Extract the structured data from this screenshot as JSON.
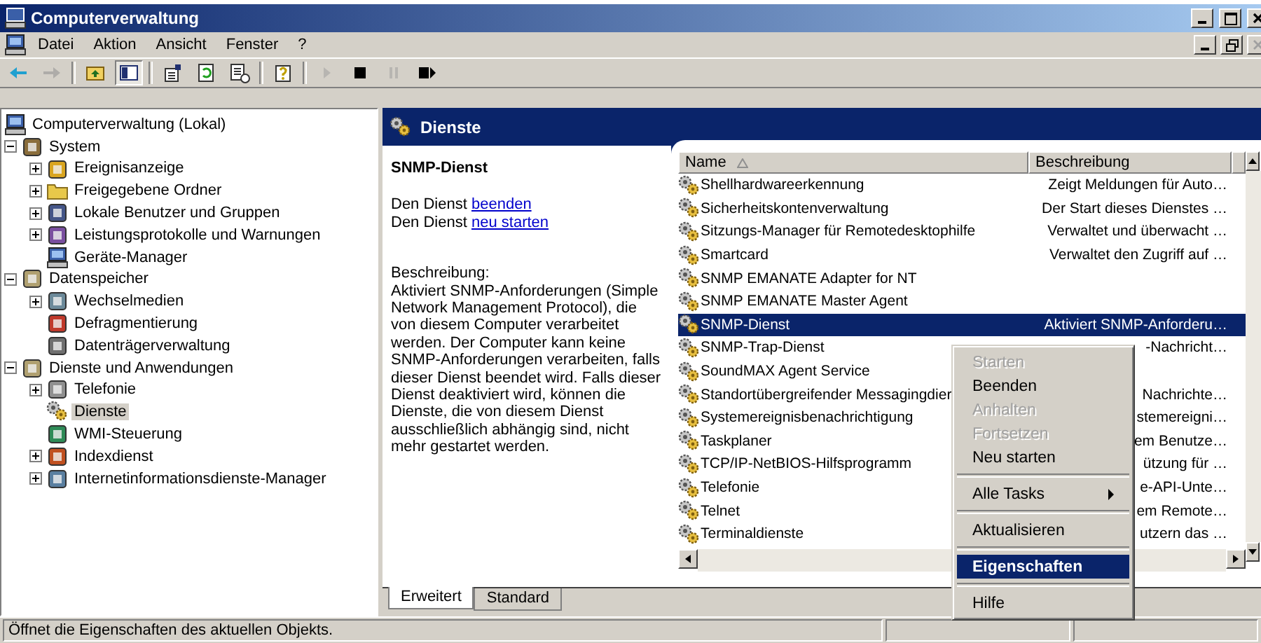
{
  "window": {
    "title": "Computerverwaltung"
  },
  "menu": [
    "Datei",
    "Aktion",
    "Ansicht",
    "Fenster",
    "?"
  ],
  "toolbar": [
    {
      "kind": "back",
      "disabled": false,
      "pressed": false
    },
    {
      "kind": "forward",
      "disabled": true,
      "pressed": false
    },
    {
      "kind": "sep"
    },
    {
      "kind": "up",
      "disabled": false,
      "pressed": false
    },
    {
      "kind": "tree",
      "disabled": false,
      "pressed": true
    },
    {
      "kind": "sep"
    },
    {
      "kind": "properties",
      "disabled": false,
      "pressed": false
    },
    {
      "kind": "refresh",
      "disabled": false,
      "pressed": false
    },
    {
      "kind": "export",
      "disabled": false,
      "pressed": false
    },
    {
      "kind": "sep"
    },
    {
      "kind": "help",
      "disabled": false,
      "pressed": false
    },
    {
      "kind": "sep"
    },
    {
      "kind": "play",
      "disabled": true,
      "pressed": false
    },
    {
      "kind": "stop",
      "disabled": false,
      "pressed": false
    },
    {
      "kind": "pause",
      "disabled": true,
      "pressed": false
    },
    {
      "kind": "restart",
      "disabled": false,
      "pressed": false
    }
  ],
  "tree": [
    {
      "label": "Computerverwaltung (Lokal)",
      "kind": "computer",
      "selected": false,
      "children": [
        {
          "label": "System",
          "kind": "tools",
          "selected": false,
          "expanded": true,
          "children": [
            {
              "label": "Ereignisanzeige",
              "kind": "log",
              "selected": false,
              "expanded": false
            },
            {
              "label": "Freigegebene Ordner",
              "kind": "folder",
              "selected": false,
              "expanded": false
            },
            {
              "label": "Lokale Benutzer und Gruppen",
              "kind": "users",
              "selected": false,
              "expanded": false
            },
            {
              "label": "Leistungsprotokolle und Warnungen",
              "kind": "chart",
              "selected": false,
              "expanded": false
            },
            {
              "label": "Geräte-Manager",
              "kind": "computer",
              "selected": false
            }
          ]
        },
        {
          "label": "Datenspeicher",
          "kind": "storage",
          "selected": false,
          "expanded": true,
          "children": [
            {
              "label": "Wechselmedien",
              "kind": "media",
              "selected": false,
              "expanded": false
            },
            {
              "label": "Defragmentierung",
              "kind": "defrag",
              "selected": false
            },
            {
              "label": "Datenträgerverwaltung",
              "kind": "disk",
              "selected": false
            }
          ]
        },
        {
          "label": "Dienste und Anwendungen",
          "kind": "storage",
          "selected": false,
          "expanded": true,
          "children": [
            {
              "label": "Telefonie",
              "kind": "phone",
              "selected": false,
              "expanded": false
            },
            {
              "label": "Dienste",
              "kind": "gear",
              "selected": true
            },
            {
              "label": "WMI-Steuerung",
              "kind": "wmi",
              "selected": false
            },
            {
              "label": "Indexdienst",
              "kind": "index",
              "selected": false,
              "expanded": false
            },
            {
              "label": "Internetinformationsdienste-Manager",
              "kind": "web",
              "selected": false,
              "expanded": false
            }
          ]
        }
      ]
    }
  ],
  "pane": {
    "title": "Dienste",
    "service": "SNMP-Dienst",
    "actions": [
      {
        "prefix": "Den Dienst",
        "link": "beenden"
      },
      {
        "prefix": "Den Dienst",
        "link": "neu starten"
      }
    ],
    "description_label": "Beschreibung:",
    "description": "Aktiviert SNMP-Anforderungen (Simple Network Management Protocol), die von diesem Computer verarbeitet werden. Der Computer kann keine SNMP-Anforderungen verarbeiten, falls dieser Dienst beendet wird. Falls dieser Dienst deaktiviert wird, können die Dienste, die von diesem Dienst ausschließlich abhängig sind, nicht mehr gestartet werden."
  },
  "table": {
    "columns": [
      "Name",
      "Beschreibung"
    ],
    "rows": [
      {
        "name": "Shellhardwareerkennung",
        "description": "Zeigt Meldungen für Auto…",
        "selected": false
      },
      {
        "name": "Sicherheitskontenverwaltung",
        "description": "Der Start dieses Dienstes …",
        "selected": false
      },
      {
        "name": "Sitzungs-Manager für Remotedesktophilfe",
        "description": "Verwaltet und überwacht …",
        "selected": false
      },
      {
        "name": "Smartcard",
        "description": "Verwaltet den Zugriff auf …",
        "selected": false
      },
      {
        "name": "SNMP EMANATE Adapter for NT",
        "selected": false
      },
      {
        "name": "SNMP EMANATE Master Agent",
        "selected": false
      },
      {
        "name": "SNMP-Dienst",
        "description": "Aktiviert SNMP-Anforderu…",
        "selected": true
      },
      {
        "name": "SNMP-Trap-Dienst",
        "description": "-Nachricht…",
        "selected": false
      },
      {
        "name": "SoundMAX Agent Service",
        "selected": false
      },
      {
        "name": "Standortübergreifender Messagingdier",
        "description": "Nachrichte…",
        "selected": false
      },
      {
        "name": "Systemereignisbenachrichtigung",
        "description": "stemereigni…",
        "selected": false
      },
      {
        "name": "Taskplaner",
        "description": "em Benutze…",
        "selected": false
      },
      {
        "name": "TCP/IP-NetBIOS-Hilfsprogramm",
        "description": "ützung für …",
        "selected": false
      },
      {
        "name": "Telefonie",
        "description": "e-API-Unte…",
        "selected": false
      },
      {
        "name": "Telnet",
        "description": "em Remote…",
        "selected": false
      },
      {
        "name": "Terminaldienste",
        "description": "utzern das …",
        "selected": false
      }
    ]
  },
  "tabs": [
    {
      "label": "Erweitert",
      "selected": true
    },
    {
      "label": "Standard",
      "selected": false
    }
  ],
  "context_menu": [
    {
      "kind": "item",
      "label": "Starten",
      "disabled": true,
      "selected": false
    },
    {
      "kind": "item",
      "label": "Beenden",
      "disabled": false,
      "selected": false
    },
    {
      "kind": "item",
      "label": "Anhalten",
      "disabled": true,
      "selected": false
    },
    {
      "kind": "item",
      "label": "Fortsetzen",
      "disabled": true,
      "selected": false
    },
    {
      "kind": "item",
      "label": "Neu starten",
      "disabled": false,
      "selected": false
    },
    {
      "kind": "separator"
    },
    {
      "kind": "submenu",
      "label": "Alle Tasks",
      "disabled": false,
      "selected": false
    },
    {
      "kind": "separator"
    },
    {
      "kind": "item",
      "label": "Aktualisieren",
      "disabled": false,
      "selected": false
    },
    {
      "kind": "separator"
    },
    {
      "kind": "item",
      "label": "Eigenschaften",
      "disabled": false,
      "selected": true
    },
    {
      "kind": "separator"
    },
    {
      "kind": "item",
      "label": "Hilfe",
      "disabled": false,
      "selected": false
    }
  ],
  "status_bar": {
    "text": "Öffnet die Eigenschaften des aktuellen Objekts."
  }
}
